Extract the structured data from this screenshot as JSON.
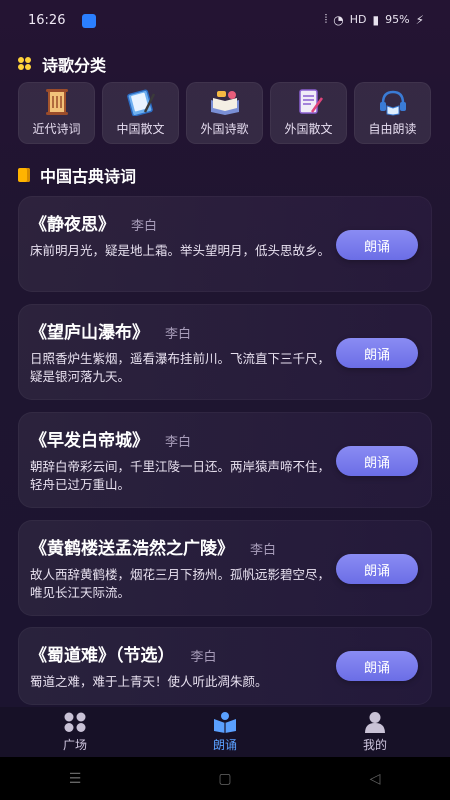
{
  "status": {
    "time": "16:26",
    "right_text": "HD",
    "battery": "95%"
  },
  "categories": {
    "title": "诗歌分类",
    "items": [
      {
        "label": "近代诗词",
        "icon": "scroll-icon"
      },
      {
        "label": "中国散文",
        "icon": "notebook-pen-icon"
      },
      {
        "label": "外国诗歌",
        "icon": "open-book-icon"
      },
      {
        "label": "外国散文",
        "icon": "document-pen-icon"
      },
      {
        "label": "自由朗读",
        "icon": "headphones-book-icon"
      }
    ]
  },
  "classics": {
    "title": "中国古典诗词",
    "button_label": "朗诵",
    "poems": [
      {
        "title": "《静夜思》",
        "author": "李白",
        "excerpt": "床前明月光，疑是地上霜。举头望明月，低头思故乡。"
      },
      {
        "title": "《望庐山瀑布》",
        "author": "李白",
        "excerpt": "日照香炉生紫烟，遥看瀑布挂前川。飞流直下三千尺，疑是银河落九天。"
      },
      {
        "title": "《早发白帝城》",
        "author": "李白",
        "excerpt": "朝辞白帝彩云间，千里江陵一日还。两岸猿声啼不住，轻舟已过万重山。"
      },
      {
        "title": "《黄鹤楼送孟浩然之广陵》",
        "author": "李白",
        "excerpt": "故人西辞黄鹤楼，烟花三月下扬州。孤帆远影碧空尽，唯见长江天际流。"
      },
      {
        "title": "《蜀道难》（节选）",
        "author": "李白",
        "excerpt": "蜀道之难，难于上青天！使人听此凋朱颜。"
      }
    ]
  },
  "bottom_nav": {
    "items": [
      {
        "label": "广场",
        "icon": "grid-icon"
      },
      {
        "label": "朗诵",
        "icon": "reading-book-icon"
      },
      {
        "label": "我的",
        "icon": "person-icon"
      }
    ],
    "active_index": 1
  }
}
